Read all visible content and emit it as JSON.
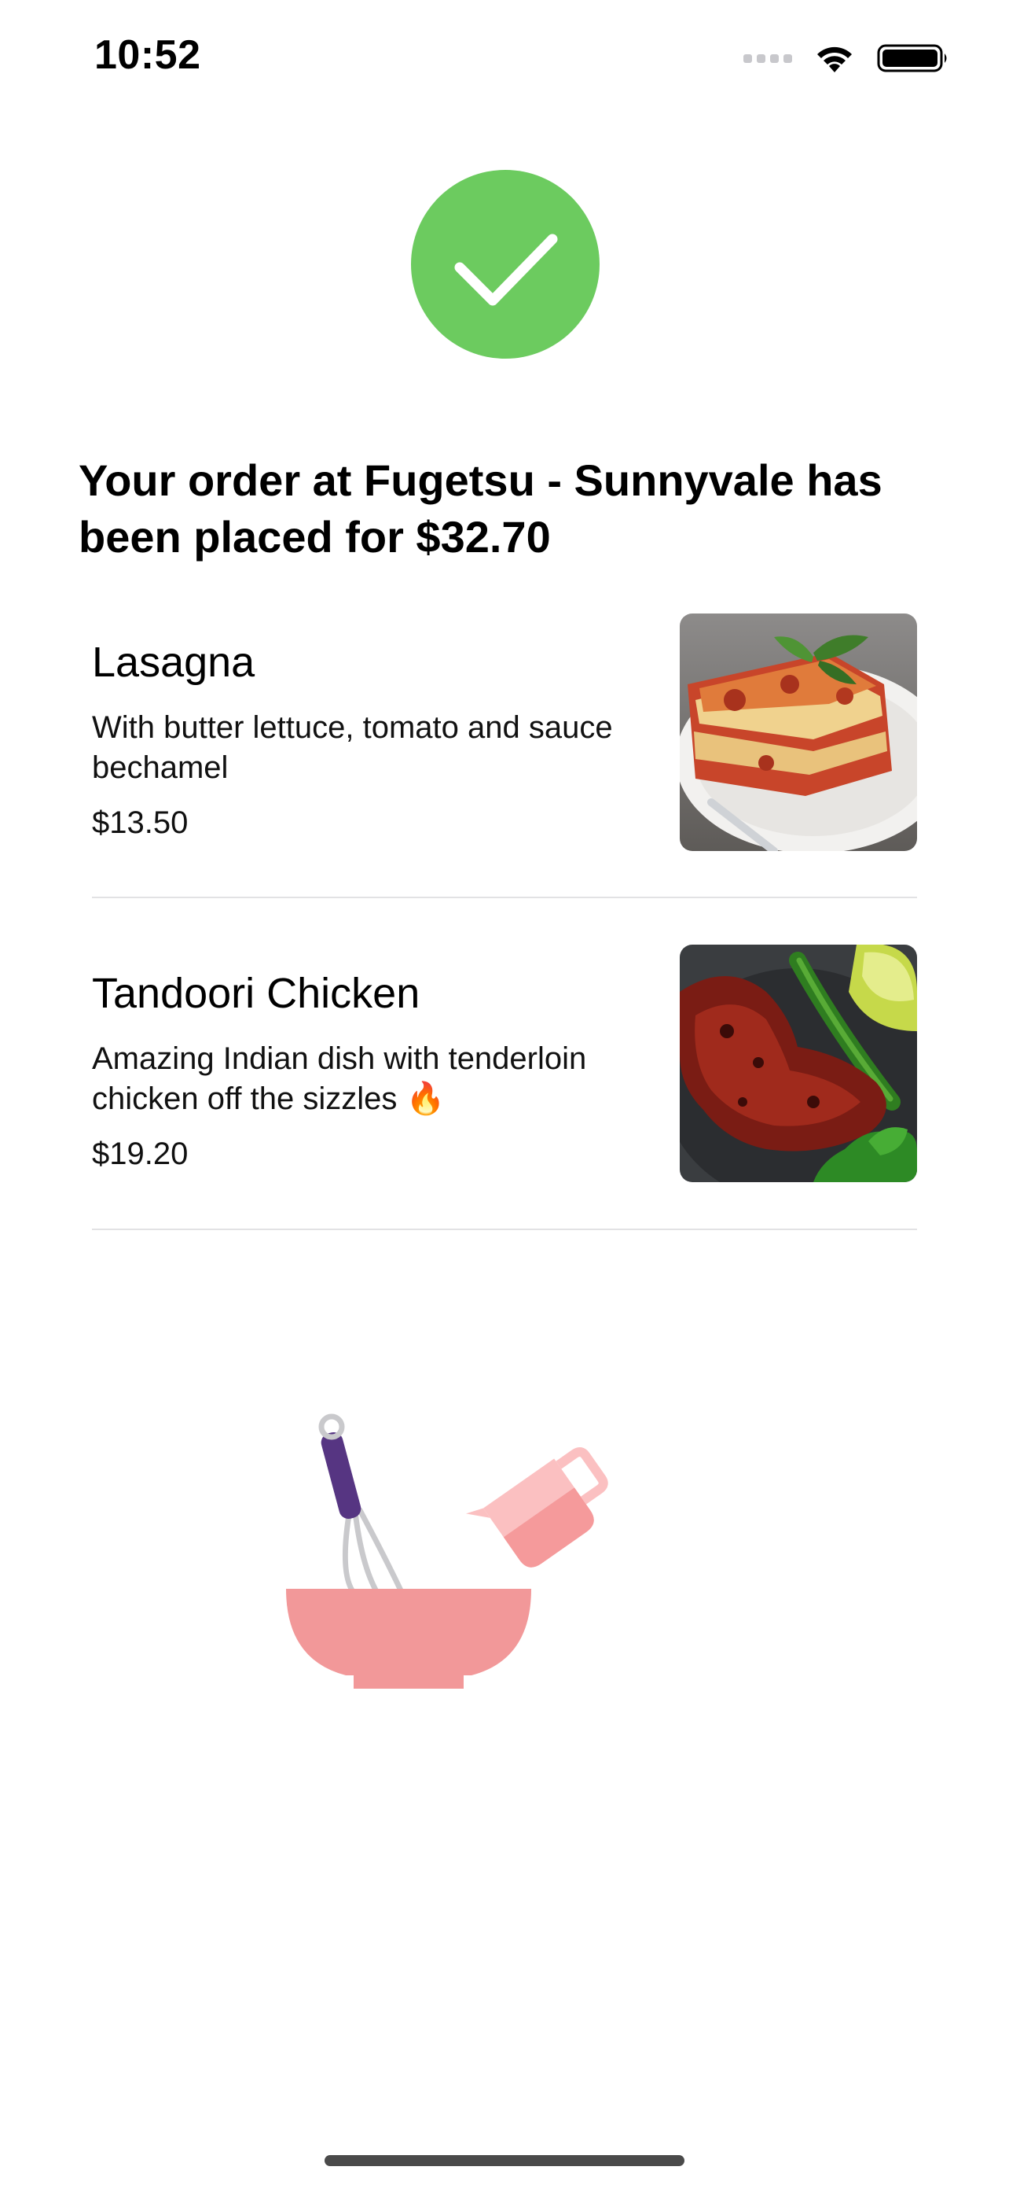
{
  "status_bar": {
    "time": "10:52"
  },
  "confirmation": {
    "headline": "Your order at Fugetsu - Sunnyvale has been placed for $32.70",
    "accent_color": "#6CCB5F"
  },
  "order_items": [
    {
      "name": "Lasagna",
      "description": "With butter lettuce, tomato and sauce bechamel",
      "price": "$13.50",
      "image": "lasagna-photo"
    },
    {
      "name": "Tandoori Chicken",
      "description": "Amazing Indian dish with tenderloin chicken off the sizzles 🔥",
      "price": "$19.20",
      "image": "tandoori-chicken-photo"
    }
  ],
  "illustration": {
    "icon": "mixing-bowl-whisk-measuring-cup-icon"
  }
}
